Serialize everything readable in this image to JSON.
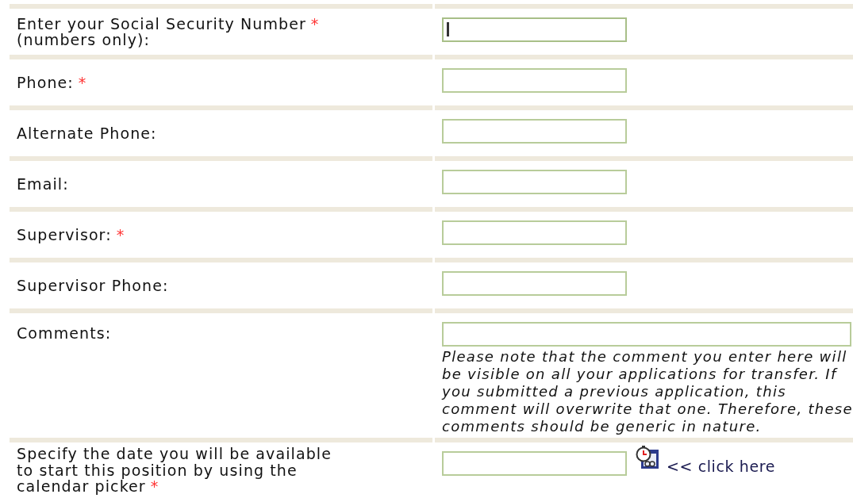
{
  "rows": [
    {
      "label": "Enter your Social Security Number",
      "required_mark": "*",
      "label_line2": "(numbers only):",
      "field": {
        "kind": "short",
        "focused": true
      }
    },
    {
      "label": "Phone:",
      "required_mark": "*",
      "field": {
        "kind": "short",
        "focused": false
      }
    },
    {
      "label": "Alternate Phone:",
      "field": {
        "kind": "short",
        "focused": false
      }
    },
    {
      "label": "Email:",
      "field": {
        "kind": "short",
        "focused": false
      }
    },
    {
      "label": "Supervisor:",
      "required_mark": "*",
      "field": {
        "kind": "short",
        "focused": false
      }
    },
    {
      "label": "Supervisor Phone:",
      "field": {
        "kind": "short",
        "focused": false
      }
    },
    {
      "label": "Comments:",
      "field": {
        "kind": "long",
        "focused": false
      },
      "note": "Please note that the comment you enter here will be visible on all your applications for transfer. If you submitted a previous application, this comment will overwrite that one. Therefore, these comments should be generic in nature."
    },
    {
      "label": "Specify the date you will be available to start this position by using the calendar picker",
      "required_mark": "*",
      "field": {
        "kind": "short",
        "focused": false
      },
      "picker_link": "<< click here"
    }
  ]
}
